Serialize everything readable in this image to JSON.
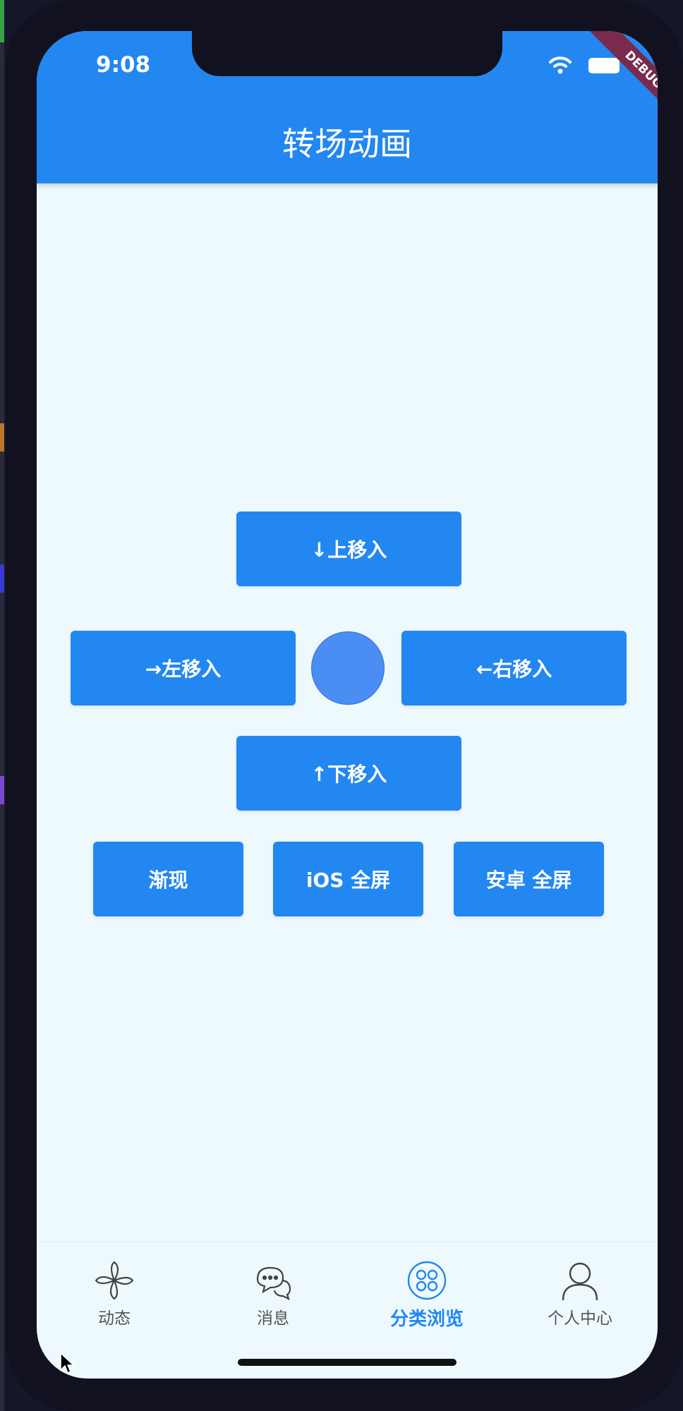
{
  "status_bar": {
    "time": "9:08"
  },
  "debug_label": "DEBUG",
  "appbar": {
    "title": "转场动画"
  },
  "buttons": {
    "up": "↓上移入",
    "left": "→左移入",
    "right": "←右移入",
    "down": "↑下移入",
    "fade": "渐现",
    "ios_fullscreen": "iOS 全屏",
    "android_fullscreen": "安卓 全屏"
  },
  "tabs": [
    {
      "label": "动态",
      "icon": "pinwheel-icon",
      "active": false
    },
    {
      "label": "消息",
      "icon": "chat-bubbles-icon",
      "active": false
    },
    {
      "label": "分类浏览",
      "icon": "category-icon",
      "active": true
    },
    {
      "label": "个人中心",
      "icon": "person-icon",
      "active": false
    }
  ],
  "colors": {
    "primary": "#2387f1",
    "background": "#eef9fd",
    "circle": "#4a8ef4",
    "inactive_text": "#555555"
  }
}
